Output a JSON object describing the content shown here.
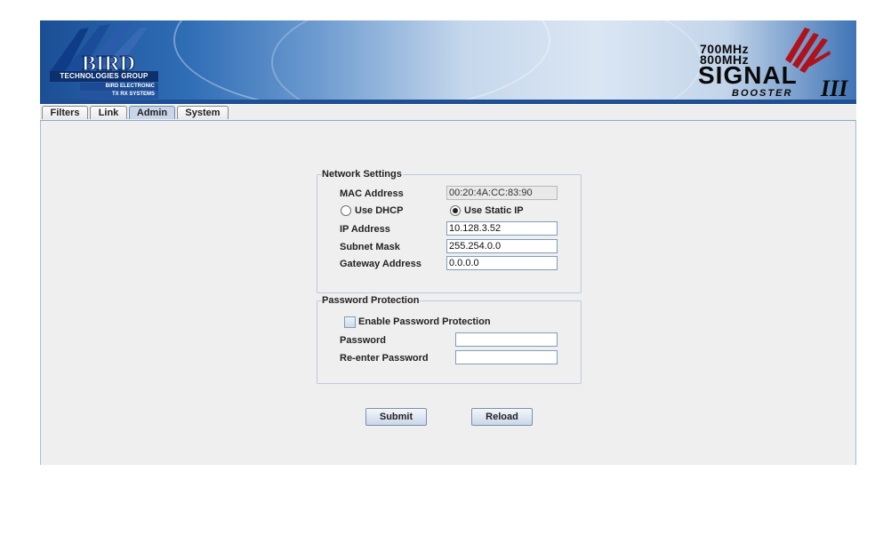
{
  "header": {
    "logo_left": {
      "brand": "BIRD",
      "line1": "TECHNOLOGIES GROUP",
      "line2": "BIRD ELECTRONIC",
      "line3": "TX RX SYSTEMS"
    },
    "logo_right": {
      "freq1": "700MHz",
      "freq2": "800MHz",
      "product": "SIGNAL",
      "sub": "BOOSTER",
      "version": "III"
    },
    "colors": {
      "banner_blue": "#1f4f95",
      "logo_red": "#b0121b"
    }
  },
  "tabs": [
    {
      "label": "Filters",
      "active": false
    },
    {
      "label": "Link",
      "active": false
    },
    {
      "label": "Admin",
      "active": true
    },
    {
      "label": "System",
      "active": false
    }
  ],
  "network": {
    "legend": "Network Settings",
    "mac_label": "MAC Address",
    "mac_value": "00:20:4A:CC:83:90",
    "dhcp_label": "Use DHCP",
    "static_label": "Use Static IP",
    "mode_selected": "static",
    "ip_label": "IP Address",
    "ip_value": "10.128.3.52",
    "subnet_label": "Subnet Mask",
    "subnet_value": "255.254.0.0",
    "gateway_label": "Gateway Address",
    "gateway_value": "0.0.0.0"
  },
  "password": {
    "legend": "Password Protection",
    "enable_label": "Enable Password Protection",
    "enable_checked": false,
    "password_label": "Password",
    "password_value": "",
    "reenter_label": "Re-enter Password",
    "reenter_value": ""
  },
  "actions": {
    "submit_label": "Submit",
    "reload_label": "Reload"
  }
}
